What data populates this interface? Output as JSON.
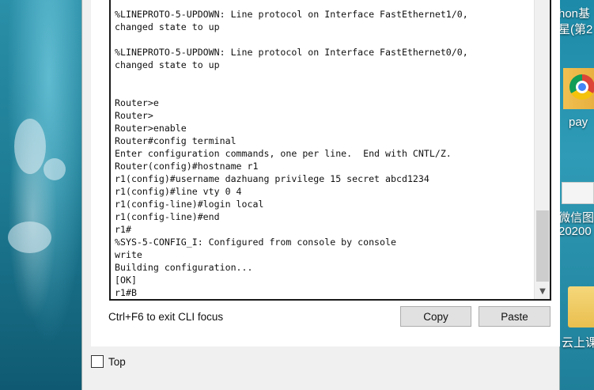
{
  "terminal": {
    "lines": [
      "%LINEPROTO-5-UPDOWN: Line protocol on Interface FastEthernet1/0,",
      "changed state to up",
      "",
      "%LINEPROTO-5-UPDOWN: Line protocol on Interface FastEthernet0/0,",
      "changed state to up",
      "",
      "",
      "Router>e",
      "Router>",
      "Router>enable",
      "Router#config terminal",
      "Enter configuration commands, one per line.  End with CNTL/Z.",
      "Router(config)#hostname r1",
      "r1(config)#username dazhuang privilege 15 secret abcd1234",
      "r1(config)#line vty 0 4",
      "r1(config-line)#login local",
      "r1(config-line)#end",
      "r1#",
      "%SYS-5-CONFIG_I: Configured from console by console",
      "write",
      "Building configuration...",
      "[OK]",
      "r1#B"
    ]
  },
  "footer": {
    "cli_hint": "Ctrl+F6 to exit CLI focus",
    "copy_label": "Copy",
    "paste_label": "Paste",
    "top_label": "Top",
    "top_checked": false
  },
  "desktop": {
    "text1": "hon基",
    "text2": "星(第2",
    "chrome_label": "pay",
    "wechat_label": "微信图片",
    "wechat_sub": "20200",
    "folder_label": "云上课"
  },
  "icons": {
    "scroll_down": "chevron-down-icon",
    "checkbox": "checkbox-icon"
  }
}
